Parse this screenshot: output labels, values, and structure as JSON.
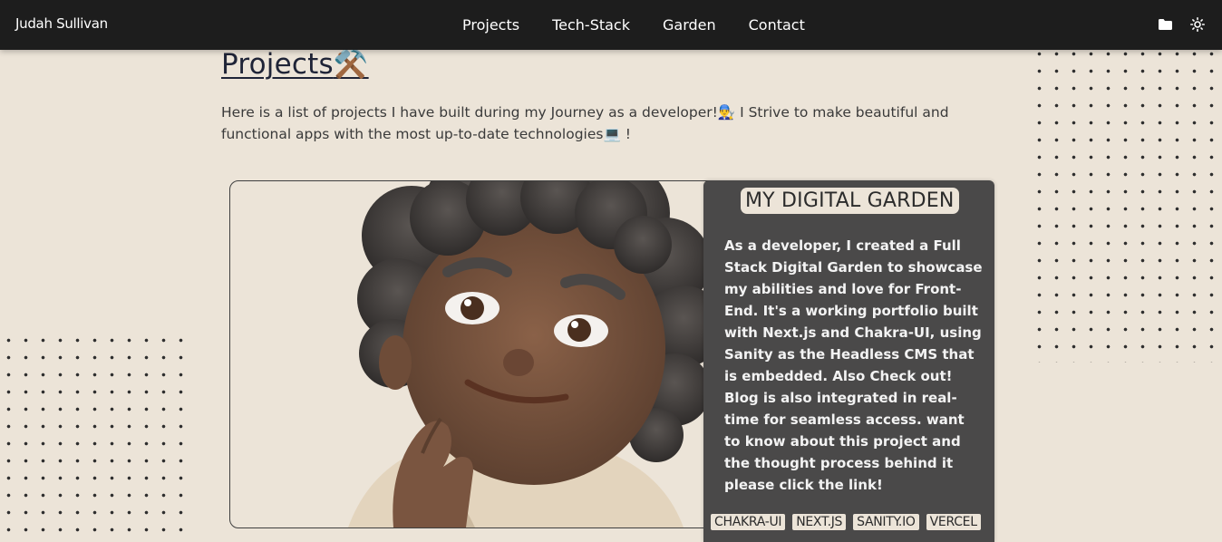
{
  "header": {
    "brand": "Judah Sullivan",
    "nav": [
      "Projects",
      "Tech-Stack",
      "Garden",
      "Contact"
    ],
    "icons": [
      "folder-icon",
      "sun-icon"
    ]
  },
  "main": {
    "title": "Projects",
    "title_emoji": "⚒️",
    "intro_part1": "Here is a list of projects I have built during my Journey as a developer!",
    "intro_emoji1": "👨‍🔧",
    "intro_part2": " I Strive to make beautiful and functional apps with the most up-to-date technologies",
    "intro_emoji2": "💻",
    "intro_part3": " !"
  },
  "project": {
    "title": "MY DIGITAL GARDEN",
    "description": "As a developer, I created a Full Stack Digital Garden to showcase my abilities and love for Front-End. It's a working portfolio built with Next.js and Chakra-UI, using Sanity as the Headless CMS that is embedded. Also Check out! Blog is also integrated in real-time for seamless access. want to know about this project and the thought process behind it please click the link!",
    "tags": [
      "CHAKRA-UI",
      "NEXT.JS",
      "SANITY.IO",
      "VERCEL"
    ]
  },
  "colors": {
    "background": "#ece4d8",
    "navbar": "#1d1d1d",
    "panel": "#4a4949"
  }
}
